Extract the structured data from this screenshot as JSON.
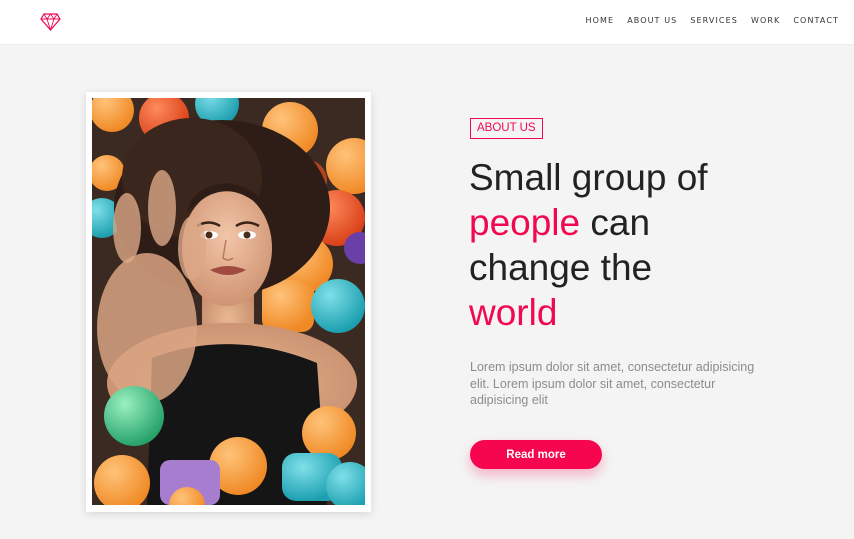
{
  "header": {
    "logo_icon": "diamond-icon",
    "nav": [
      "HOME",
      "ABOUT US",
      "SERVICES",
      "WORK",
      "CONTACT"
    ]
  },
  "hero": {
    "badge": "ABOUT US",
    "headline": {
      "line1": "Small group of",
      "line2_accent": "people",
      "line2_rest": " can",
      "line3": "change the",
      "line4_accent": "world"
    },
    "body": "Lorem ipsum dolor sit amet, consectetur adipisicing elit. Lorem ipsum dolor sit amet, consectetur adipisicing elit",
    "cta": "Read more"
  },
  "colors": {
    "accent": "#f0094f",
    "background": "#f4f4f4"
  }
}
